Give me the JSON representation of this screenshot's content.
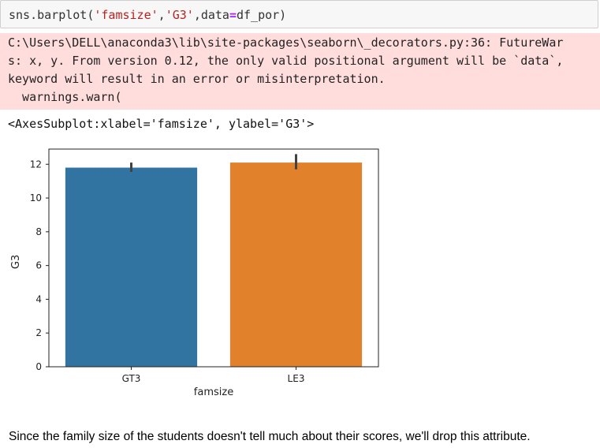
{
  "code_cell": {
    "fn": "sns.barplot(",
    "arg1": "'famsize'",
    "comma1": ",",
    "arg2": "'G3'",
    "comma2": ",data",
    "eq": "=",
    "arg3": "df_por)"
  },
  "stderr": {
    "lines": [
      "C:\\Users\\DELL\\anaconda3\\lib\\site-packages\\seaborn\\_decorators.py:36: FutureWar",
      "s: x, y. From version 0.12, the only valid positional argument will be `data`,",
      "keyword will result in an error or misinterpretation.",
      "  warnings.warn("
    ]
  },
  "result_text": "<AxesSubplot:xlabel='famsize', ylabel='G3'>",
  "chart_data": {
    "type": "bar",
    "categories": [
      "GT3",
      "LE3"
    ],
    "values": [
      11.8,
      12.1
    ],
    "error_bars": [
      [
        11.55,
        12.1
      ],
      [
        11.7,
        12.6
      ]
    ],
    "colors": [
      "#3274a1",
      "#e1812c"
    ],
    "xlabel": "famsize",
    "ylabel": "G3",
    "ylim": [
      0,
      12.9
    ],
    "yticks": [
      0,
      2,
      4,
      6,
      8,
      10,
      12
    ],
    "grid": false
  },
  "markdown_text": "Since the family size of the students doesn't tell much about their scores, we'll drop this attribute."
}
